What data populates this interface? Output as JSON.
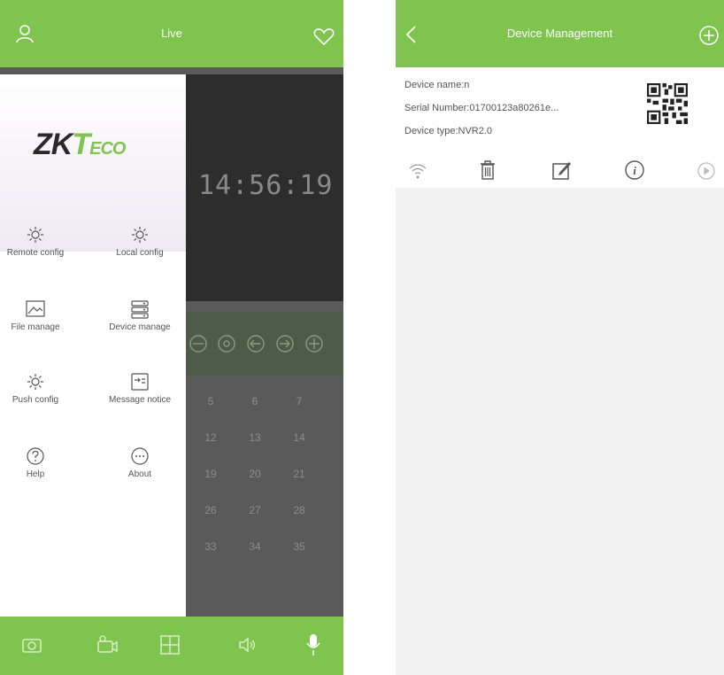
{
  "left_screen": {
    "title": "Live",
    "clock": "14:56:19",
    "logo": {
      "zk": "ZK",
      "t": "T",
      "eco": "ECO"
    },
    "menu": [
      {
        "label": "Remote config",
        "icon": "gear-icon"
      },
      {
        "label": "Local config",
        "icon": "gear-icon"
      },
      {
        "label": "File manage",
        "icon": "picture-icon"
      },
      {
        "label": "Device manage",
        "icon": "server-icon"
      },
      {
        "label": "Push config",
        "icon": "gear-icon"
      },
      {
        "label": "Message notice",
        "icon": "message-icon"
      },
      {
        "label": "Help",
        "icon": "help-icon"
      },
      {
        "label": "About",
        "icon": "more-icon"
      }
    ],
    "grid_numbers": [
      "5",
      "6",
      "7",
      "12",
      "13",
      "14",
      "19",
      "20",
      "21",
      "26",
      "27",
      "28",
      "33",
      "34",
      "35"
    ],
    "accent": "#7ec44e"
  },
  "right_screen": {
    "title": "Device Management",
    "device": {
      "name_label": "Device name:n",
      "serial_label": "Serial Number:01700123a80261e...",
      "type_label": "Device type:NVR2.0"
    }
  }
}
